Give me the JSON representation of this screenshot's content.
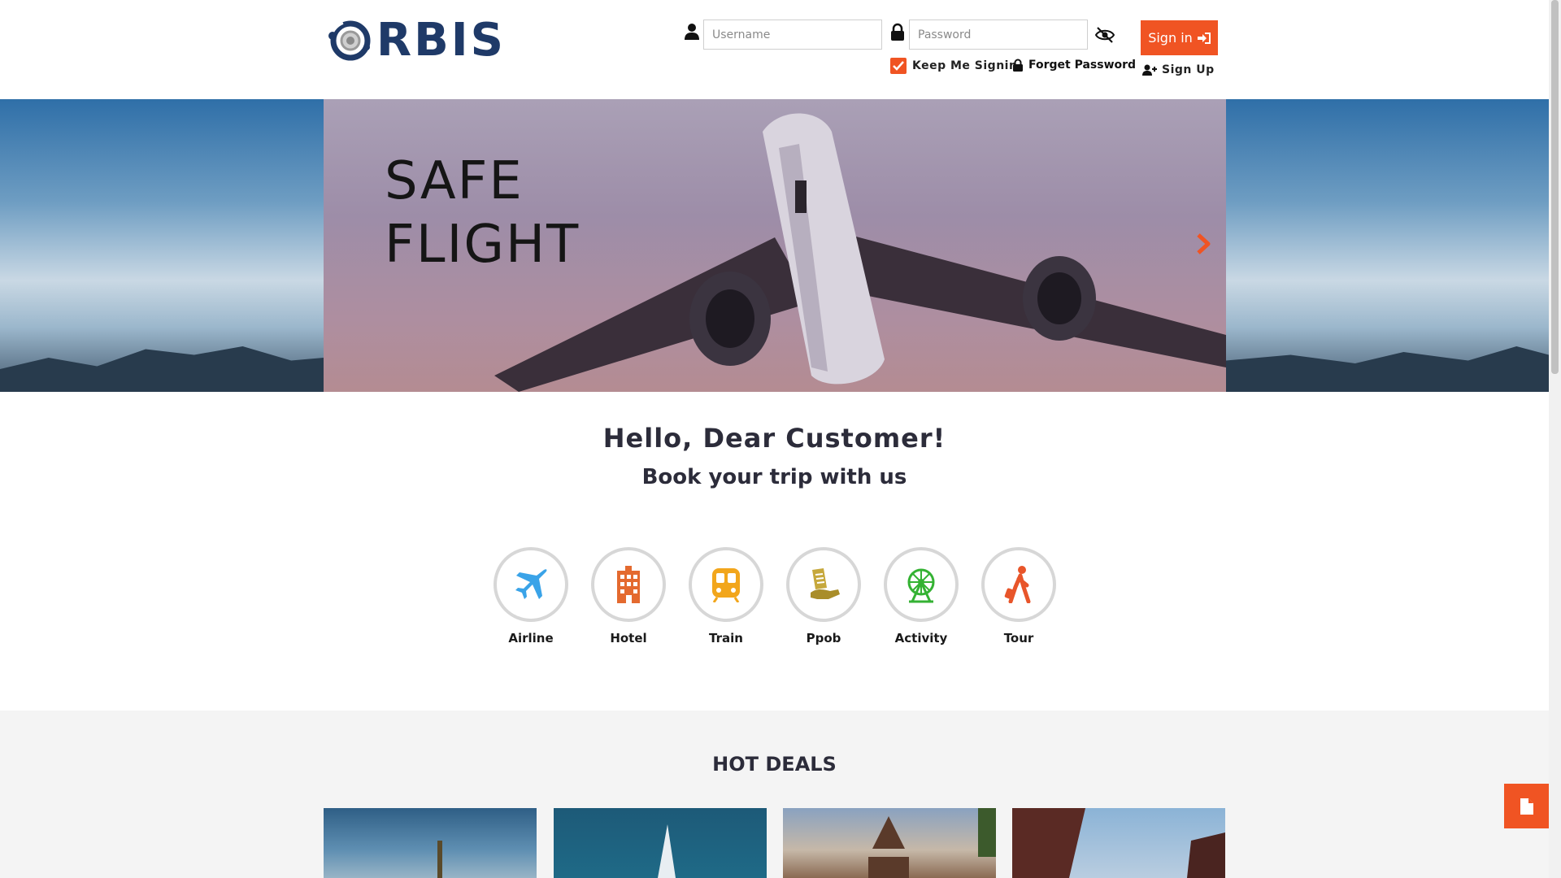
{
  "brand": {
    "logo_text": "RBIS"
  },
  "login": {
    "username_placeholder": "Username",
    "password_placeholder": "Password",
    "signin_label": "Sign in",
    "keep_label": "Keep Me Signin",
    "forget_label": "Forget Password",
    "signup_label": "Sign Up"
  },
  "hero": {
    "title": "SAFE\nFLIGHT"
  },
  "greeting": {
    "title": "Hello, Dear Customer!",
    "subtitle": "Book your trip with us"
  },
  "services": [
    {
      "label": "Airline",
      "icon": "plane-icon",
      "color": "#3aa3e8"
    },
    {
      "label": "Hotel",
      "icon": "hotel-icon",
      "color": "#e46a2f"
    },
    {
      "label": "Train",
      "icon": "train-icon",
      "color": "#f2a61c"
    },
    {
      "label": "Ppob",
      "icon": "receipt-hand-icon",
      "color": "#c6a83c"
    },
    {
      "label": "Activity",
      "icon": "ferris-wheel-icon",
      "color": "#34b233"
    },
    {
      "label": "Tour",
      "icon": "traveler-icon",
      "color": "#e8552a"
    }
  ],
  "deals": {
    "title": "HOT DEALS"
  },
  "colors": {
    "accent": "#f05423",
    "brand": "#1f3a68"
  }
}
